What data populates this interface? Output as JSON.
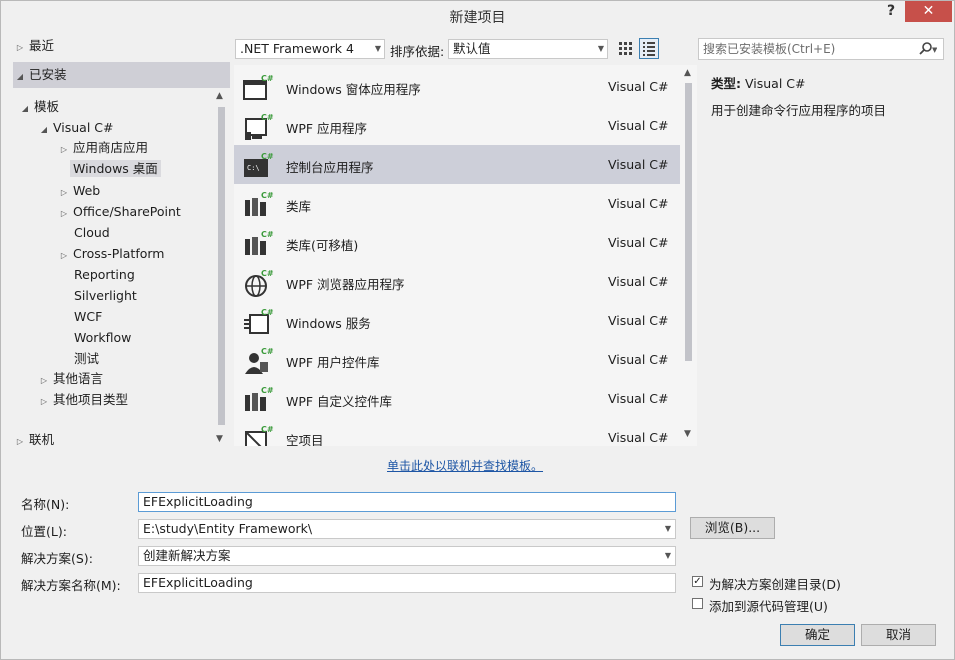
{
  "window": {
    "title": "新建项目",
    "help": "?",
    "close": "✕"
  },
  "tree": {
    "recent": "最近",
    "installed": "已安装",
    "templates": "模板",
    "visual_cs": "Visual C#",
    "children": [
      "应用商店应用",
      "Windows 桌面",
      "Web",
      "Office/SharePoint",
      "Cloud",
      "Cross-Platform",
      "Reporting",
      "Silverlight",
      "WCF",
      "Workflow",
      "测试"
    ],
    "other_languages": "其他语言",
    "other_project_types": "其他项目类型",
    "online": "联机"
  },
  "toolbar": {
    "framework": ".NET Framework 4",
    "sort_label": "排序依据:",
    "sort_value": "默认值",
    "search_placeholder": "搜索已安装模板(Ctrl+E)"
  },
  "templates": [
    {
      "name": "Windows 窗体应用程序",
      "lang": "Visual C#",
      "icon": "windows-forms-icon"
    },
    {
      "name": "WPF 应用程序",
      "lang": "Visual C#",
      "icon": "wpf-app-icon"
    },
    {
      "name": "控制台应用程序",
      "lang": "Visual C#",
      "icon": "console-app-icon"
    },
    {
      "name": "类库",
      "lang": "Visual C#",
      "icon": "class-library-icon"
    },
    {
      "name": "类库(可移植)",
      "lang": "Visual C#",
      "icon": "portable-library-icon"
    },
    {
      "name": "WPF 浏览器应用程序",
      "lang": "Visual C#",
      "icon": "browser-app-icon"
    },
    {
      "name": "Windows 服务",
      "lang": "Visual C#",
      "icon": "windows-service-icon"
    },
    {
      "name": "WPF 用户控件库",
      "lang": "Visual C#",
      "icon": "user-control-icon"
    },
    {
      "name": "WPF 自定义控件库",
      "lang": "Visual C#",
      "icon": "custom-control-icon"
    },
    {
      "name": "空项目",
      "lang": "Visual C#",
      "icon": "empty-project-icon"
    }
  ],
  "selected_template_index": 2,
  "description": {
    "type_label": "类型:",
    "type_value": "Visual C#",
    "text": "用于创建命令行应用程序的项目"
  },
  "online_link": "单击此处以联机并查找模板。",
  "form": {
    "name_label": "名称(N):",
    "name_value": "EFExplicitLoading",
    "location_label": "位置(L):",
    "location_value": "E:\\study\\Entity Framework\\",
    "solution_label": "解决方案(S):",
    "solution_value": "创建新解决方案",
    "solution_name_label": "解决方案名称(M):",
    "solution_name_value": "EFExplicitLoading",
    "browse": "浏览(B)...",
    "create_dir": "为解决方案创建目录(D)",
    "create_dir_checked": true,
    "add_source_control": "添加到源代码管理(U)",
    "add_source_control_checked": false,
    "ok": "确定",
    "cancel": "取消"
  }
}
